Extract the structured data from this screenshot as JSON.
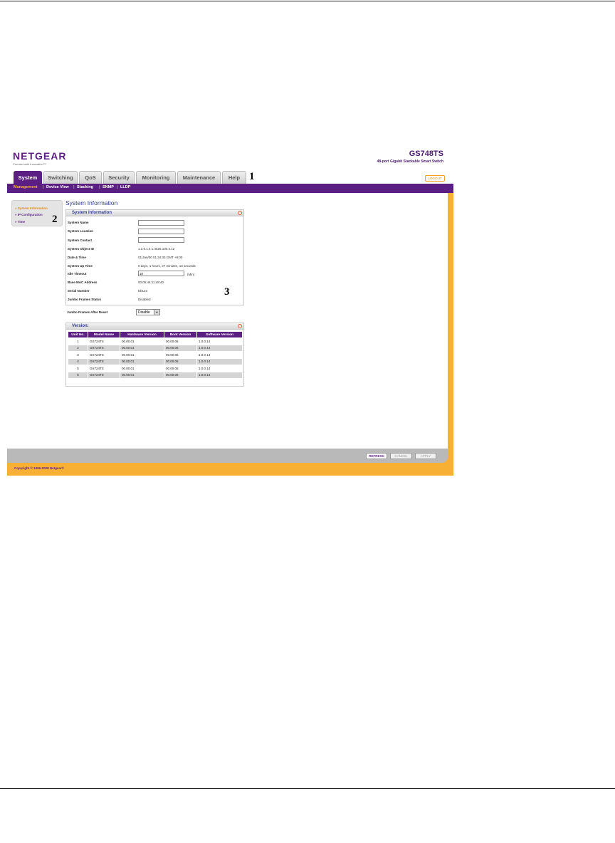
{
  "brand": {
    "logo": "NETGEAR",
    "tagline": "Connect with Innovation™",
    "model": "GS748TS",
    "model_desc": "48-port Gigabit Stackable Smart Switch"
  },
  "tabs": [
    {
      "label": "System",
      "active": true
    },
    {
      "label": "Switching"
    },
    {
      "label": "QoS"
    },
    {
      "label": "Security"
    },
    {
      "label": "Monitoring"
    },
    {
      "label": "Maintenance"
    },
    {
      "label": "Help"
    }
  ],
  "callouts": {
    "one": "1",
    "two": "2",
    "three": "3"
  },
  "logout": "LOGOUT",
  "subnav": [
    {
      "label": "Management",
      "current": true
    },
    {
      "label": "Device View"
    },
    {
      "label": "Stacking"
    },
    {
      "label": "SNMP"
    },
    {
      "label": "LLDP"
    }
  ],
  "sidebar": [
    {
      "label": "» System Information",
      "current": true
    },
    {
      "label": "» IP Configuration"
    },
    {
      "label": "» Time"
    }
  ],
  "page_title": "System Information",
  "system_info": {
    "title": "System Information",
    "fields": {
      "name_label": "System Name",
      "name_value": "",
      "location_label": "System Location",
      "location_value": "",
      "contact_label": "System Contact",
      "contact_value": "",
      "oid_label": "System Object ID",
      "oid_value": "1.3.6.1.4.1.4526.100.4.12",
      "datetime_label": "Date & Time",
      "datetime_value": "01/Jan/00  01:34:33 GMT +9:00",
      "uptime_label": "System Up Time",
      "uptime_value": "0 days, 1 hours, 27 minutes, 13 seconds",
      "idle_label": "Idle Timeout",
      "idle_value": "10",
      "idle_unit": "(Min)",
      "mac_label": "Base MAC Address",
      "mac_value": "00:05:44:11:48:40",
      "serial_label": "Serial Number",
      "serial_value": "Eb123",
      "jumbo_label": "Jumbo Frames Status",
      "jumbo_value": "Disabled",
      "jumbo_reset_label": "Jumbo Frames After Reset",
      "jumbo_reset_value": "Disable"
    }
  },
  "version": {
    "title": "Version:",
    "headers": [
      "Unit No.",
      "Model Name",
      "Hardware Version",
      "Boot Version",
      "Software Version"
    ],
    "rows": [
      [
        "1",
        "GS724TS",
        "00.00.01",
        "00.00.06",
        "1.0.0.14"
      ],
      [
        "2",
        "GS724TS",
        "00.00.01",
        "00.00.06",
        "1.0.0.14"
      ],
      [
        "3",
        "GS724TS",
        "00.00.01",
        "00.00.06",
        "1.0.0.14"
      ],
      [
        "4",
        "GS724TS",
        "00.00.01",
        "00.00.06",
        "1.0.0.14"
      ],
      [
        "5",
        "GS724TS",
        "00.00.01",
        "00.00.06",
        "1.0.0.14"
      ],
      [
        "6",
        "GS724TS",
        "00.00.01",
        "00.00.06",
        "1.0.0.14"
      ]
    ]
  },
  "buttons": {
    "refresh": "REFRESH",
    "cancel": "CANCEL",
    "apply": "APPLY"
  },
  "copyright": "Copyright © 1996-2008 Netgear®",
  "colors": {
    "purple": "#5b1f83",
    "orange": "#f7b034"
  }
}
